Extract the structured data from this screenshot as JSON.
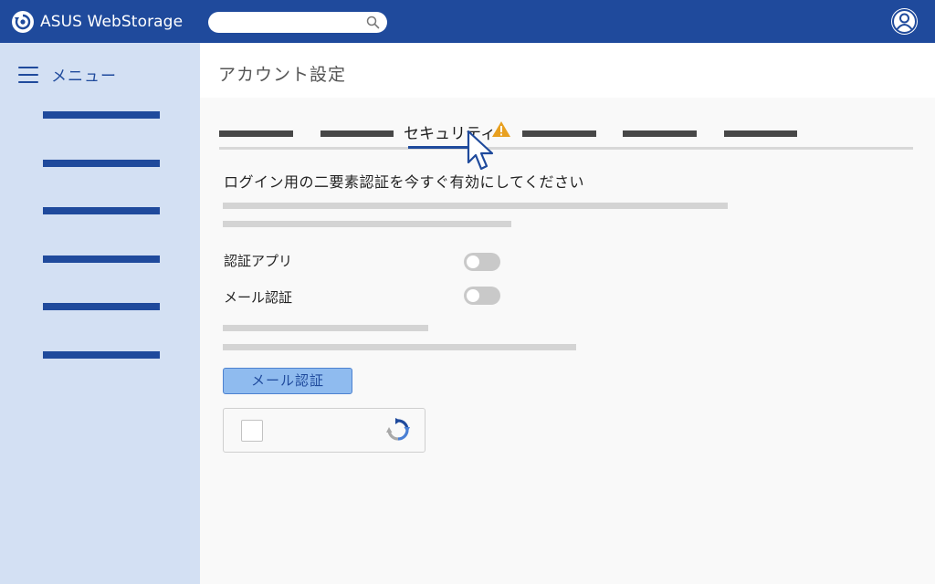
{
  "header": {
    "app_name": "ASUS WebStorage",
    "search_placeholder": ""
  },
  "sidebar": {
    "menu_label": "メニュー"
  },
  "page": {
    "title": "アカウント設定"
  },
  "tabs": {
    "active_label": "セキュリティ"
  },
  "security": {
    "headline": "ログイン用の二要素認証を今すぐ有効にしてください",
    "options": [
      {
        "label": "認証アプリ",
        "enabled": false
      },
      {
        "label": "メール認証",
        "enabled": false
      }
    ],
    "email_button_label": "メール認証"
  },
  "colors": {
    "brand": "#1f4a9c",
    "sidebar_bg": "#d3e0f3",
    "warning": "#e8a020",
    "button_bg": "#8fbbef"
  }
}
